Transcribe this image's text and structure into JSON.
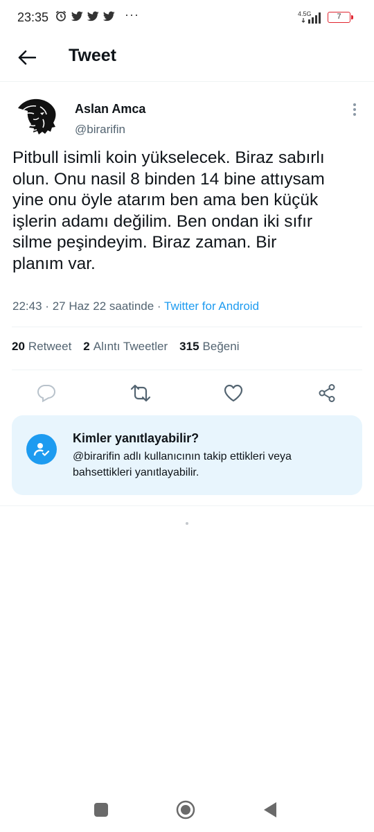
{
  "status_bar": {
    "time": "23:35",
    "network": "4.5G",
    "battery": "7",
    "overflow": "···",
    "icons": [
      "alarm-icon",
      "twitter-icon",
      "twitter-icon",
      "twitter-icon",
      "signal-icon",
      "battery-icon"
    ]
  },
  "header": {
    "title": "Tweet",
    "back_icon": "arrow-left-icon"
  },
  "tweet": {
    "author_name": "Aslan Amca",
    "author_handle": "@birarifin",
    "text": "Pitbull isimli koin yükselecek. Biraz sabırlı\nolun. Onu nasil 8 binden 14 bine attıysam\nyine onu öyle atarım ben ama ben küçük\nişlerin adamı değilim. Ben ondan iki sıfır\nsilme peşindeyim. Biraz zaman. Bir\nplanım var.",
    "time": "22:43",
    "date": "27 Haz 22 saatinde",
    "separator": "·",
    "source": "Twitter for Android"
  },
  "stats": {
    "retweets": {
      "count": "20",
      "label": "Retweet"
    },
    "quotes": {
      "count": "2",
      "label": "Alıntı Tweetler"
    },
    "likes": {
      "count": "315",
      "label": "Beğeni"
    }
  },
  "actions": [
    "reply-icon",
    "retweet-icon",
    "like-icon",
    "share-icon"
  ],
  "reply_restriction": {
    "title": "Kimler yanıtlayabilir?",
    "description": "@birarifin adlı kullanıcının takip ettikleri veya bahsettikleri yanıtlayabilir."
  },
  "colors": {
    "accent": "#1d9bf0",
    "text": "#0f1419",
    "secondary": "#536471",
    "reply_box_bg": "#e8f5fd",
    "battery": "#e0232e"
  }
}
